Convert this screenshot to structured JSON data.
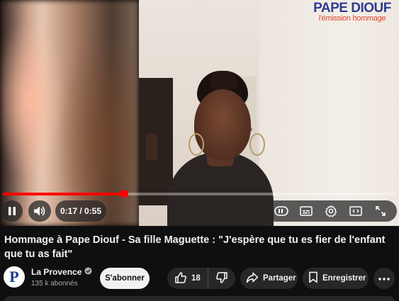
{
  "player": {
    "overlay_brand_title": "PAPE DIOUF",
    "overlay_brand_subtitle": "l'émission hommage",
    "current_time": "0:17",
    "duration": "0:55",
    "time_display": "0:17 / 0:55",
    "progress_fraction": 0.309,
    "accent_color": "#ff0000",
    "controls": {
      "left": [
        "pause-icon",
        "volume-icon"
      ],
      "right": [
        "miniplayer-toggle-icon",
        "subtitles-icon",
        "settings-icon",
        "theater-mode-icon",
        "fullscreen-icon"
      ]
    }
  },
  "video": {
    "title": "Hommage à Pape Diouf - Sa fille Maguette : \"J'espère que tu es fier de l'enfant que tu as fait\""
  },
  "channel": {
    "name": "La Provence",
    "verified": true,
    "subscribers": "135 k abonnés",
    "avatar_letter": "P",
    "subscribe_label": "S'abonner"
  },
  "actions": {
    "like_count": "18",
    "share_label": "Partager",
    "save_label": "Enregistrer"
  }
}
